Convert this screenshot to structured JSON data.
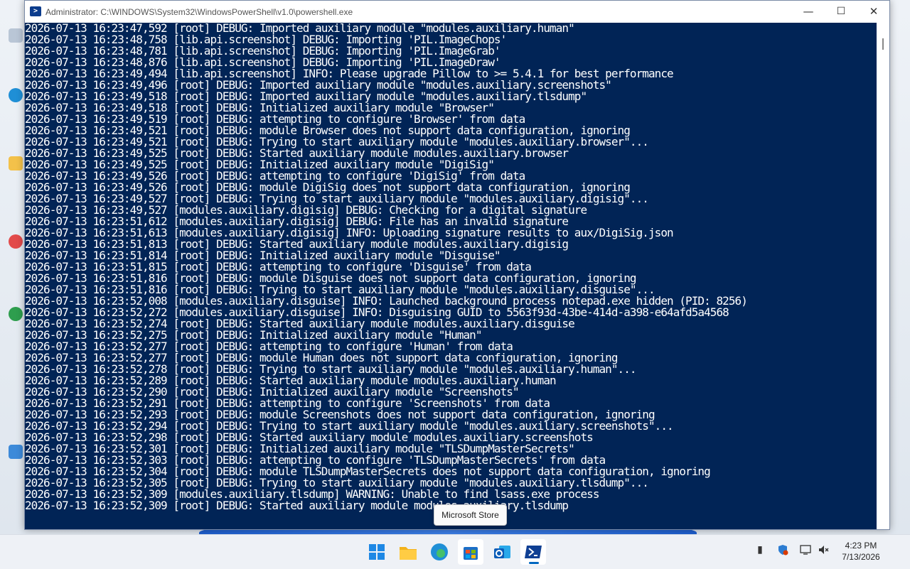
{
  "window": {
    "title": "Administrator: C:\\WINDOWS\\System32\\WindowsPowerShell\\v1.0\\powershell.exe",
    "minimize_glyph": "—",
    "maximize_glyph": "☐",
    "close_glyph": "✕"
  },
  "console": {
    "lines": [
      "2026-07-13 16:23:47,592 [root] DEBUG: Imported auxiliary module \"modules.auxiliary.human\"",
      "2026-07-13 16:23:48,758 [lib.api.screenshot] DEBUG: Importing 'PIL.ImageChops'",
      "2026-07-13 16:23:48,781 [lib.api.screenshot] DEBUG: Importing 'PIL.ImageGrab'",
      "2026-07-13 16:23:48,876 [lib.api.screenshot] DEBUG: Importing 'PIL.ImageDraw'",
      "2026-07-13 16:23:49,494 [lib.api.screenshot] INFO: Please upgrade Pillow to >= 5.4.1 for best performance",
      "2026-07-13 16:23:49,496 [root] DEBUG: Imported auxiliary module \"modules.auxiliary.screenshots\"",
      "2026-07-13 16:23:49,518 [root] DEBUG: Imported auxiliary module \"modules.auxiliary.tlsdump\"",
      "2026-07-13 16:23:49,518 [root] DEBUG: Initialized auxiliary module \"Browser\"",
      "2026-07-13 16:23:49,519 [root] DEBUG: attempting to configure 'Browser' from data",
      "2026-07-13 16:23:49,521 [root] DEBUG: module Browser does not support data configuration, ignoring",
      "2026-07-13 16:23:49,521 [root] DEBUG: Trying to start auxiliary module \"modules.auxiliary.browser\"...",
      "2026-07-13 16:23:49,525 [root] DEBUG: Started auxiliary module modules.auxiliary.browser",
      "2026-07-13 16:23:49,525 [root] DEBUG: Initialized auxiliary module \"DigiSig\"",
      "2026-07-13 16:23:49,526 [root] DEBUG: attempting to configure 'DigiSig' from data",
      "2026-07-13 16:23:49,526 [root] DEBUG: module DigiSig does not support data configuration, ignoring",
      "2026-07-13 16:23:49,527 [root] DEBUG: Trying to start auxiliary module \"modules.auxiliary.digisig\"...",
      "2026-07-13 16:23:49,527 [modules.auxiliary.digisig] DEBUG: Checking for a digital signature",
      "2026-07-13 16:23:51,612 [modules.auxiliary.digisig] DEBUG: File has an invalid signature",
      "2026-07-13 16:23:51,613 [modules.auxiliary.digisig] INFO: Uploading signature results to aux/DigiSig.json",
      "2026-07-13 16:23:51,813 [root] DEBUG: Started auxiliary module modules.auxiliary.digisig",
      "2026-07-13 16:23:51,814 [root] DEBUG: Initialized auxiliary module \"Disguise\"",
      "2026-07-13 16:23:51,815 [root] DEBUG: attempting to configure 'Disguise' from data",
      "2026-07-13 16:23:51,816 [root] DEBUG: module Disguise does not support data configuration, ignoring",
      "2026-07-13 16:23:51,816 [root] DEBUG: Trying to start auxiliary module \"modules.auxiliary.disguise\"...",
      "2026-07-13 16:23:52,008 [modules.auxiliary.disguise] INFO: Launched background process notepad.exe hidden (PID: 8256)",
      "2026-07-13 16:23:52,272 [modules.auxiliary.disguise] INFO: Disguising GUID to 5563f93d-43be-414d-a398-e64afd5a4568",
      "2026-07-13 16:23:52,274 [root] DEBUG: Started auxiliary module modules.auxiliary.disguise",
      "2026-07-13 16:23:52,275 [root] DEBUG: Initialized auxiliary module \"Human\"",
      "2026-07-13 16:23:52,277 [root] DEBUG: attempting to configure 'Human' from data",
      "2026-07-13 16:23:52,277 [root] DEBUG: module Human does not support data configuration, ignoring",
      "2026-07-13 16:23:52,278 [root] DEBUG: Trying to start auxiliary module \"modules.auxiliary.human\"...",
      "2026-07-13 16:23:52,289 [root] DEBUG: Started auxiliary module modules.auxiliary.human",
      "2026-07-13 16:23:52,290 [root] DEBUG: Initialized auxiliary module \"Screenshots\"",
      "2026-07-13 16:23:52,291 [root] DEBUG: attempting to configure 'Screenshots' from data",
      "2026-07-13 16:23:52,293 [root] DEBUG: module Screenshots does not support data configuration, ignoring",
      "2026-07-13 16:23:52,294 [root] DEBUG: Trying to start auxiliary module \"modules.auxiliary.screenshots\"...",
      "2026-07-13 16:23:52,298 [root] DEBUG: Started auxiliary module modules.auxiliary.screenshots",
      "2026-07-13 16:23:52,301 [root] DEBUG: Initialized auxiliary module \"TLSDumpMasterSecrets\"",
      "2026-07-13 16:23:52,303 [root] DEBUG: attempting to configure 'TLSDumpMasterSecrets' from data",
      "2026-07-13 16:23:52,304 [root] DEBUG: module TLSDumpMasterSecrets does not support data configuration, ignoring",
      "2026-07-13 16:23:52,305 [root] DEBUG: Trying to start auxiliary module \"modules.auxiliary.tlsdump\"...",
      "2026-07-13 16:23:52,309 [modules.auxiliary.tlsdump] WARNING: Unable to find lsass.exe process",
      "2026-07-13 16:23:52,309 [root] DEBUG: Started auxiliary module modules.auxiliary.tlsdump"
    ]
  },
  "tooltip": {
    "text": "Microsoft Store"
  },
  "taskbar": {
    "items": [
      {
        "name": "start",
        "icon": "windows-logo-icon",
        "color": "#1e88e5"
      },
      {
        "name": "file-explorer",
        "icon": "folder-icon",
        "color": "#f3b21b"
      },
      {
        "name": "edge",
        "icon": "edge-icon",
        "color": "#1f8fd6"
      },
      {
        "name": "microsoft-store",
        "icon": "store-icon",
        "color": "#1c6fc7"
      },
      {
        "name": "outlook",
        "icon": "outlook-icon",
        "color": "#1a73c8"
      },
      {
        "name": "powershell",
        "icon": "powershell-icon",
        "color": "#0f3f93"
      }
    ],
    "clock": {
      "time": "4:23 PM",
      "date": "7/13/2026"
    }
  },
  "colors": {
    "console_bg": "#012456",
    "console_fg": "#ffffff",
    "accent": "#0067c0"
  }
}
